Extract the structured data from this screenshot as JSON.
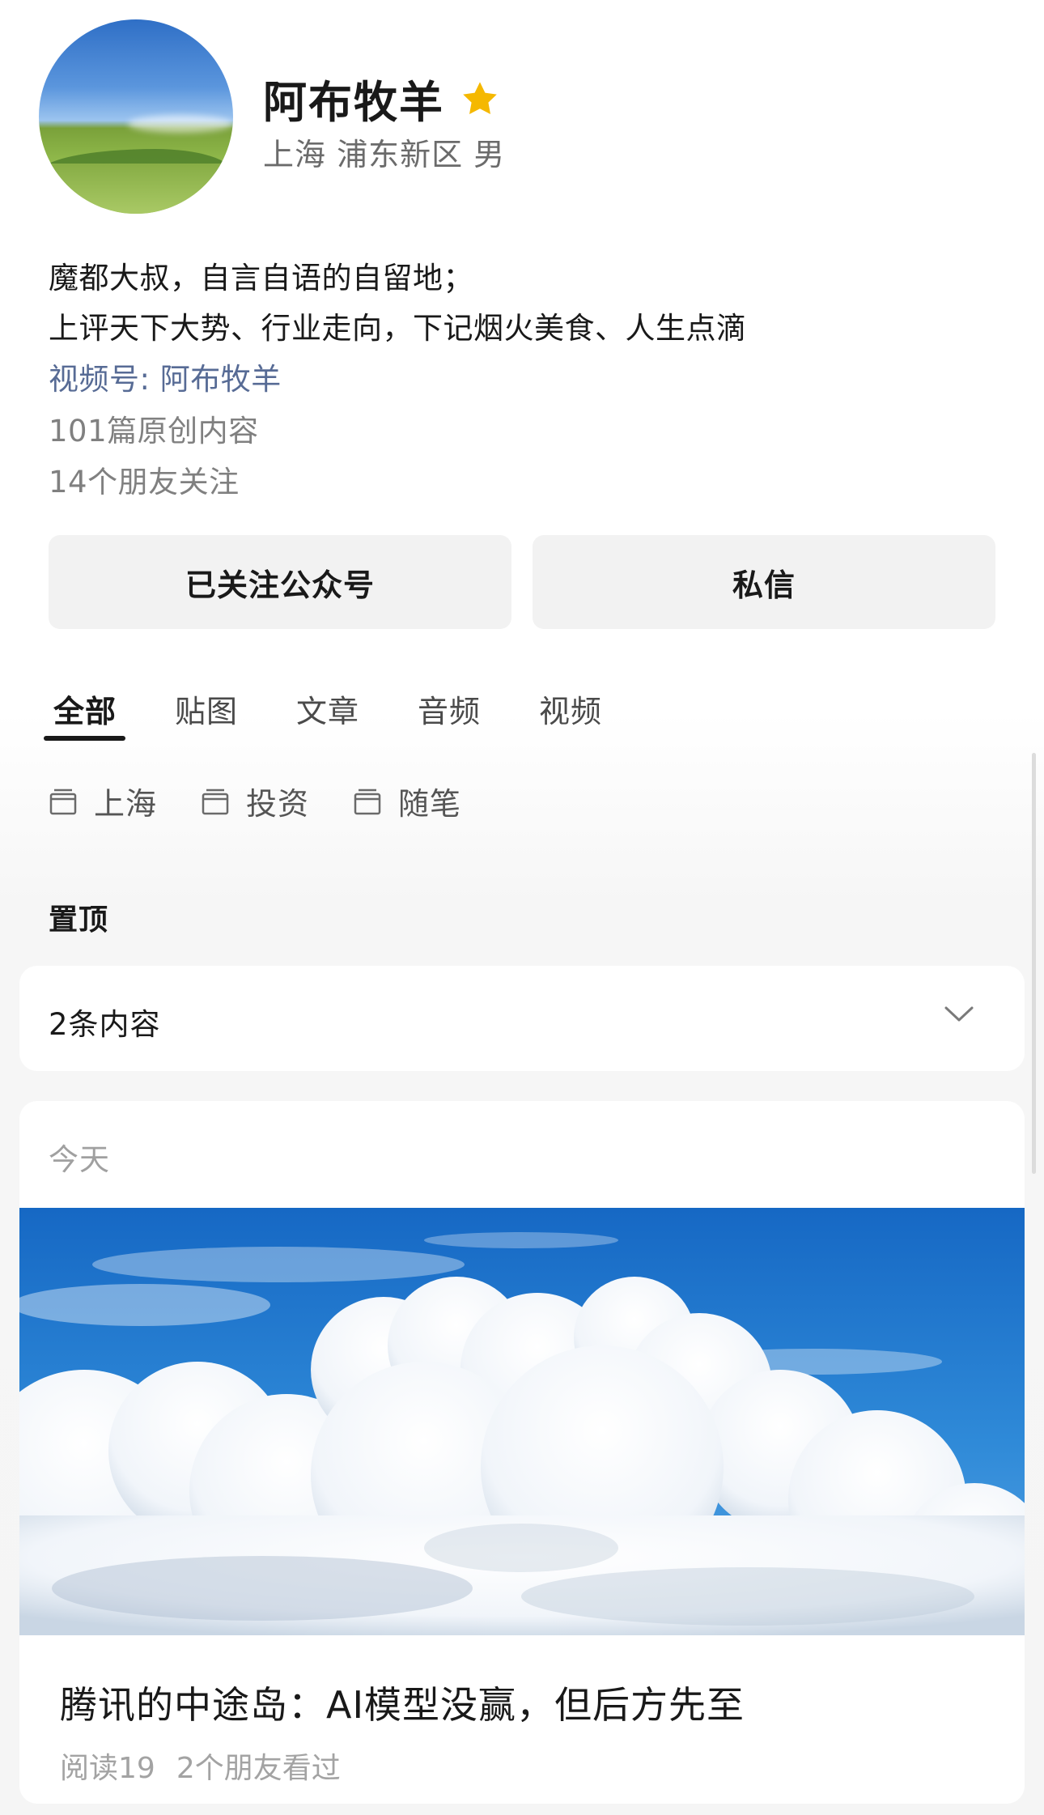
{
  "profile": {
    "name": "阿布牧羊",
    "location": "上海 浦东新区 男",
    "bio_lines": [
      "魔都大叔，自言自语的自留地；",
      "上评天下大势、行业走向，下记烟火美食、人生点滴"
    ],
    "channel_link": "视频号: 阿布牧羊",
    "original_count": "101篇原创内容",
    "friends_following": "14个朋友关注",
    "star_icon": "star-icon",
    "star_color": "#f5b800"
  },
  "actions": {
    "follow_label": "已关注公众号",
    "message_label": "私信"
  },
  "tabs": [
    {
      "label": "全部",
      "active": true
    },
    {
      "label": "贴图",
      "active": false
    },
    {
      "label": "文章",
      "active": false
    },
    {
      "label": "音频",
      "active": false
    },
    {
      "label": "视频",
      "active": false
    }
  ],
  "albums": [
    {
      "label": "上海",
      "icon": "album-icon"
    },
    {
      "label": "投资",
      "icon": "album-icon"
    },
    {
      "label": "随笔",
      "icon": "album-icon"
    }
  ],
  "pinned": {
    "title": "置顶",
    "count_label": "2条内容",
    "expand_icon": "chevron-down-icon"
  },
  "feed": {
    "date_label": "今天",
    "article": {
      "title": "腾讯的中途岛：AI模型没赢，但后方先至",
      "reads": "阅读19",
      "friends_read": "2个朋友看过"
    }
  },
  "colors": {
    "link": "#576b95",
    "secondary_text": "#808080",
    "button_bg": "#f2f2f2"
  }
}
